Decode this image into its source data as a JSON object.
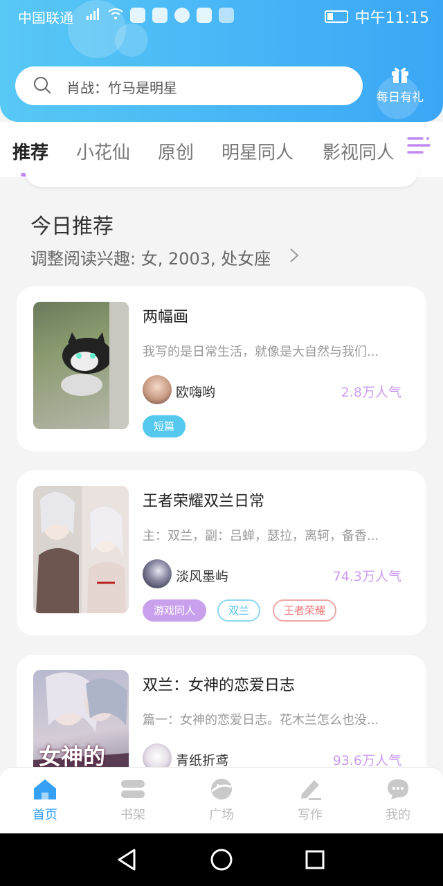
{
  "status_bar": {
    "carrier": "中国联通",
    "time": "中午11:15"
  },
  "search": {
    "placeholder": "肖战：竹马是明星"
  },
  "gift": {
    "label": "每日有礼"
  },
  "tabs": [
    {
      "label": "推荐",
      "active": true
    },
    {
      "label": "小花仙"
    },
    {
      "label": "原创"
    },
    {
      "label": "明星同人"
    },
    {
      "label": "影视同人"
    }
  ],
  "section": {
    "title": "今日推荐",
    "subtitle": "调整阅读兴趣: 女, 2003, 处女座"
  },
  "books": [
    {
      "title": "两幅画",
      "description": "我写的是日常生活，就像是大自然与我们...",
      "author": "欧嗨哟",
      "popularity": "2.8万人气",
      "tags": [
        "短篇"
      ]
    },
    {
      "title": "王者荣耀双兰日常",
      "description": "主：双兰，副：吕蝉，瑟拉，离轲，备香...",
      "author": "淡风墨屿",
      "popularity": "74.3万人气",
      "tags": [
        "游戏同人",
        "双兰",
        "王者荣耀"
      ]
    },
    {
      "title": "双兰：女神的恋爱日志",
      "description": "篇一：女神的恋爱日志。花木兰怎么也没...",
      "author": "青纸折鸢",
      "popularity": "93.6万人气",
      "cover_text": "女神的",
      "tags": []
    }
  ],
  "bottom_nav": [
    {
      "label": "首页",
      "icon": "home-icon",
      "active": true
    },
    {
      "label": "书架",
      "icon": "bookshelf-icon"
    },
    {
      "label": "广场",
      "icon": "plaza-icon"
    },
    {
      "label": "写作",
      "icon": "write-icon"
    },
    {
      "label": "我的",
      "icon": "profile-icon"
    }
  ],
  "colors": {
    "header_start": "#58c8f5",
    "header_end": "#3aa6f6",
    "accent_purple": "#c089f2",
    "popularity": "#cc9cf0",
    "nav_active": "#36a0f4"
  }
}
